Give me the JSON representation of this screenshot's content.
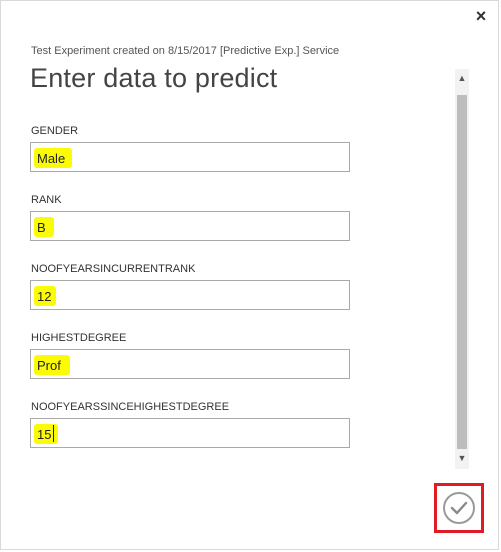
{
  "dialog": {
    "close_glyph": "×",
    "subtitle": "Test Experiment created on 8/15/2017 [Predictive Exp.] Service",
    "title": "Enter data to predict"
  },
  "fields": [
    {
      "label": "GENDER",
      "value": "Male"
    },
    {
      "label": "RANK",
      "value": "B"
    },
    {
      "label": "NOOFYEARSINCURRENTRANK",
      "value": "12"
    },
    {
      "label": "HIGHESTDEGREE",
      "value": "Prof"
    },
    {
      "label": "NOOFYEARSSINCEHIGHESTDEGREE",
      "value": "15"
    }
  ],
  "scrollbar": {
    "up_glyph": "▲",
    "down_glyph": "▼"
  },
  "colors": {
    "highlight": "#fbfb05",
    "focus_box": "#e01b23",
    "check_mark": "#8a8a8a"
  },
  "icons": {
    "close": "close-icon",
    "confirm": "checkmark-icon"
  }
}
